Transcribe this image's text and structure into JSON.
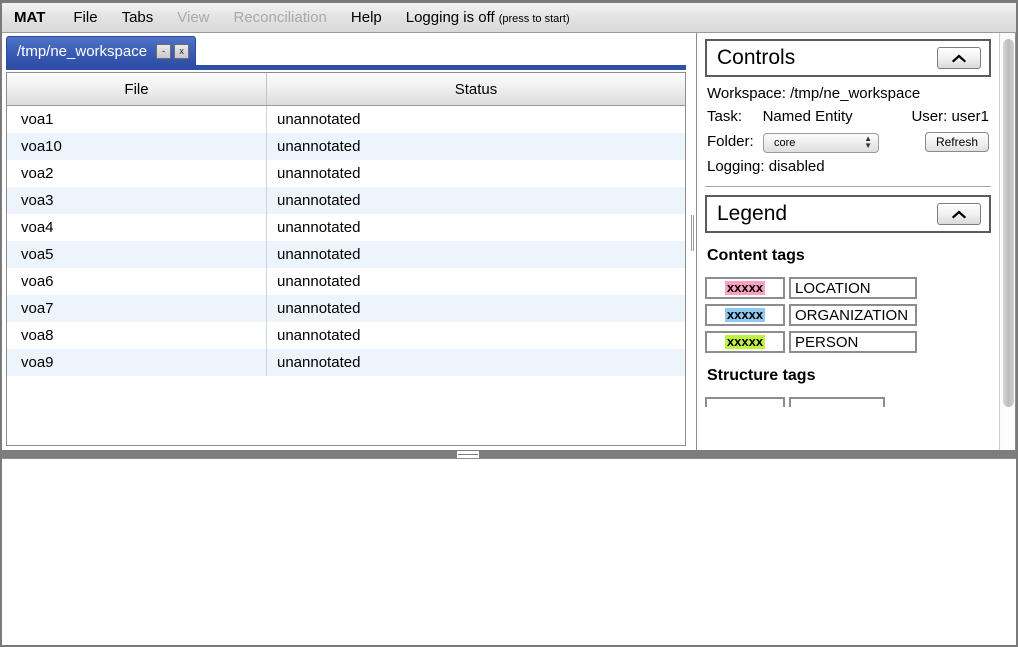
{
  "menubar": {
    "items": [
      {
        "label": "MAT",
        "state": "brand"
      },
      {
        "label": "File",
        "state": "enabled"
      },
      {
        "label": "Tabs",
        "state": "enabled"
      },
      {
        "label": "View",
        "state": "disabled"
      },
      {
        "label": "Reconciliation",
        "state": "disabled"
      },
      {
        "label": "Help",
        "state": "enabled"
      }
    ],
    "logging_status": "Logging is off",
    "logging_hint": "(press to start)"
  },
  "tab": {
    "label": "/tmp/ne_workspace",
    "minimize_label": "-",
    "close_label": "x"
  },
  "table": {
    "columns": [
      "File",
      "Status"
    ],
    "rows": [
      {
        "file": "voa1",
        "status": "unannotated"
      },
      {
        "file": "voa10",
        "status": "unannotated"
      },
      {
        "file": "voa2",
        "status": "unannotated"
      },
      {
        "file": "voa3",
        "status": "unannotated"
      },
      {
        "file": "voa4",
        "status": "unannotated"
      },
      {
        "file": "voa5",
        "status": "unannotated"
      },
      {
        "file": "voa6",
        "status": "unannotated"
      },
      {
        "file": "voa7",
        "status": "unannotated"
      },
      {
        "file": "voa8",
        "status": "unannotated"
      },
      {
        "file": "voa9",
        "status": "unannotated"
      }
    ]
  },
  "controls": {
    "title": "Controls",
    "collapse_icon": "chevron-up-icon",
    "workspace_label": "Workspace:",
    "workspace_value": "/tmp/ne_workspace",
    "task_label": "Task:",
    "task_value": "Named Entity",
    "user_label": "User:",
    "user_value": "user1",
    "folder_label": "Folder:",
    "folder_value": "core",
    "folder_options": [
      "core"
    ],
    "refresh_label": "Refresh",
    "logging_label": "Logging:",
    "logging_value": "disabled"
  },
  "legend": {
    "title": "Legend",
    "collapse_icon": "chevron-up-icon",
    "content_tags_title": "Content tags",
    "swatch_text": "xxxxx",
    "content_tags": [
      {
        "name": "LOCATION",
        "color": "#ff9fc4"
      },
      {
        "name": "ORGANIZATION",
        "color": "#8fc9f0"
      },
      {
        "name": "PERSON",
        "color": "#c0f040"
      }
    ],
    "structure_tags_title": "Structure tags",
    "structure_tags": [
      {
        "name": "",
        "color": "#ffffff"
      }
    ]
  }
}
